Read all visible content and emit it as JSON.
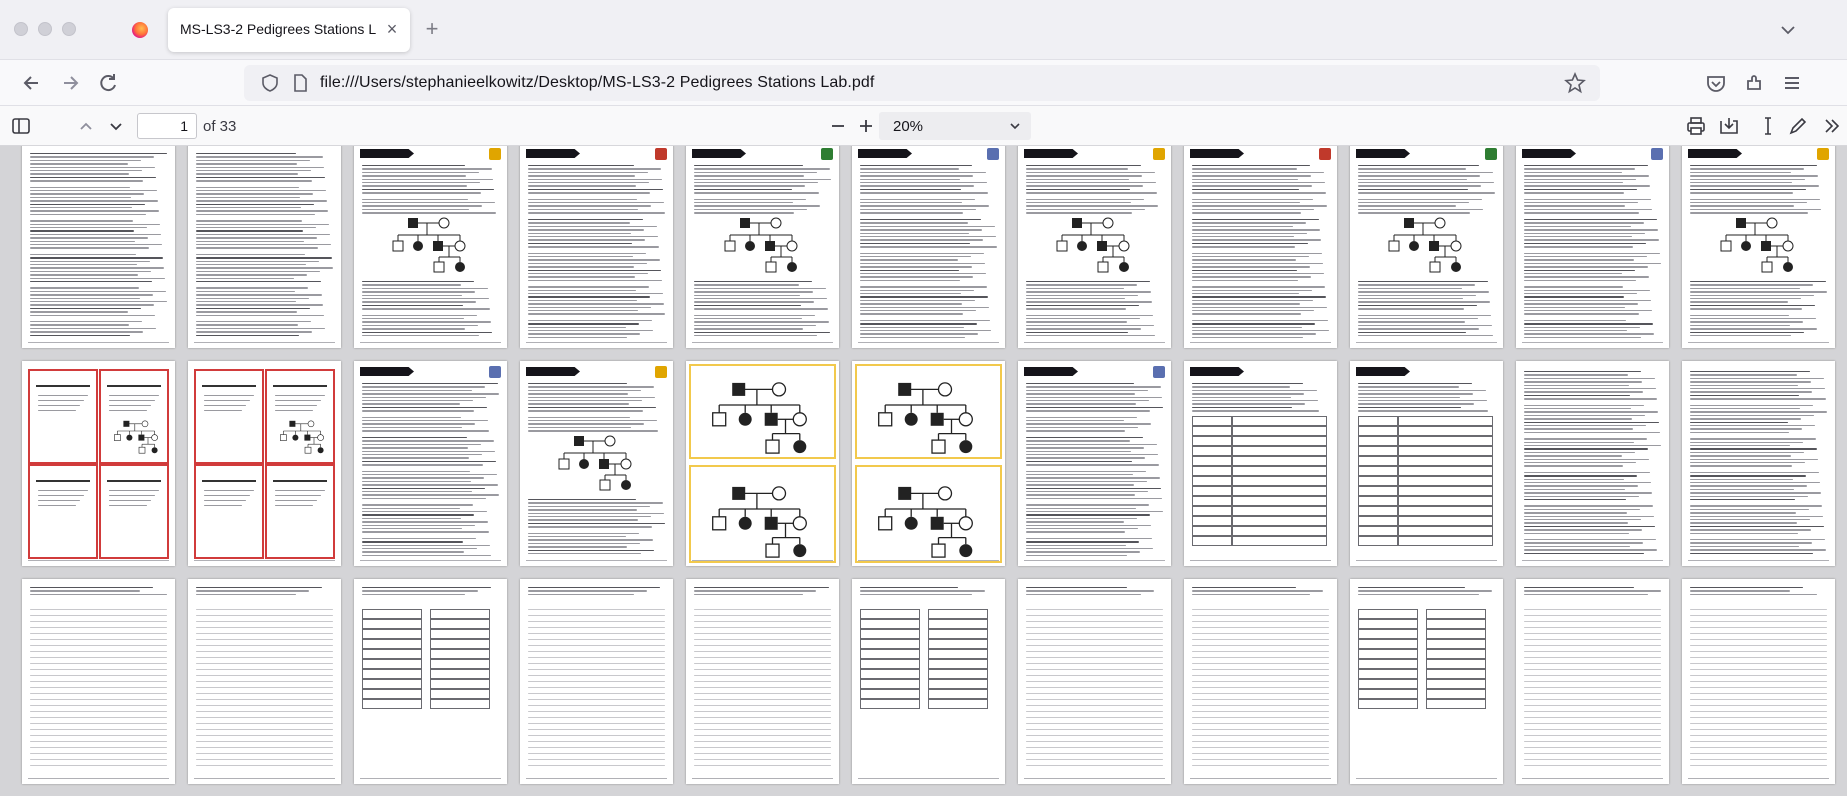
{
  "window": {
    "tab_title": "MS-LS3-2 Pedigrees Stations Lab.pdf",
    "url": "file:///Users/stephanieelkowitz/Desktop/MS-LS3-2 Pedigrees Stations Lab.pdf"
  },
  "pdf_toolbar": {
    "page_number": "1",
    "page_total": "of 33",
    "zoom": "20%"
  },
  "pages": {
    "count": 33,
    "types": [
      "text",
      "text",
      "station",
      "station",
      "station",
      "station",
      "station",
      "station",
      "station",
      "station",
      "station",
      "cards",
      "cards",
      "station",
      "station",
      "pedigree",
      "pedigree",
      "station",
      "table",
      "table",
      "text",
      "text",
      "sheet",
      "sheet",
      "sheet",
      "sheet",
      "sheet",
      "sheet",
      "sheet",
      "sheet",
      "sheet",
      "sheet",
      "sheet"
    ]
  },
  "colors": {
    "accent": "#0060df",
    "card_border": "#d13b3b",
    "pedigree_frame": "#f2c94c",
    "viewer_bg": "#d4d4d7"
  },
  "icons": [
    "sidebar-toggle-icon",
    "chevron-up-icon",
    "chevron-down-icon",
    "zoom-out-icon",
    "zoom-in-icon",
    "print-icon",
    "save-icon",
    "text-cursor-icon",
    "draw-icon",
    "more-tools-icon",
    "back-icon",
    "forward-icon",
    "reload-icon",
    "shield-icon",
    "page-icon",
    "bookmark-star-icon",
    "pocket-icon",
    "extensions-icon",
    "menu-icon",
    "firefox-logo-icon",
    "close-icon",
    "new-tab-icon",
    "tab-list-icon"
  ]
}
